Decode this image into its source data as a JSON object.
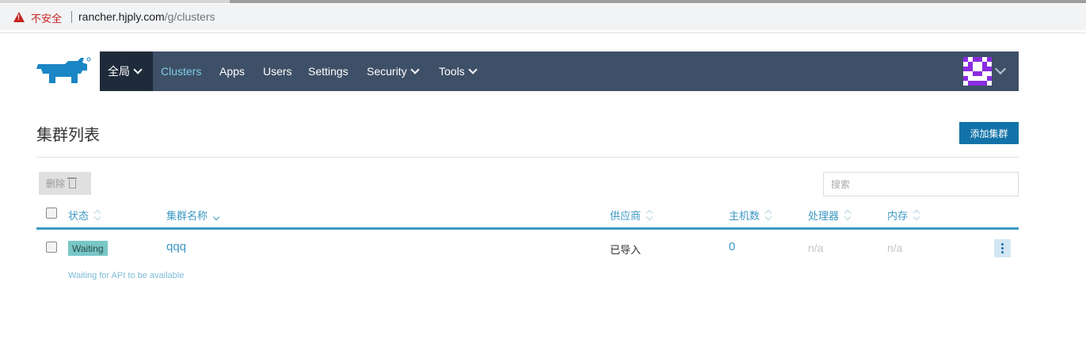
{
  "browser": {
    "insecure_label": "不安全",
    "url_host": "rancher.hjply.com",
    "url_path": "/g/clusters"
  },
  "nav": {
    "global_label": "全局",
    "items": [
      {
        "label": "Clusters"
      },
      {
        "label": "Apps"
      },
      {
        "label": "Users"
      },
      {
        "label": "Settings"
      },
      {
        "label": "Security"
      },
      {
        "label": "Tools"
      }
    ]
  },
  "header": {
    "title": "集群列表",
    "add_button": "添加集群"
  },
  "toolbar": {
    "delete_label": "删除",
    "search_placeholder": "搜索"
  },
  "table": {
    "columns": [
      "状态",
      "集群名称",
      "供应商",
      "主机数",
      "处理器",
      "内存"
    ],
    "rows": [
      {
        "state": "Waiting",
        "name": "qqq",
        "provider": "已导入",
        "nodes": "0",
        "cpu": "n/a",
        "memory": "n/a",
        "message": "Waiting for API to be available"
      }
    ]
  },
  "colors": {
    "nav_bg": "#3e5067",
    "nav_active": "#7ecbe6",
    "primary": "#1273a8",
    "link": "#3d98c4",
    "badge": "#79c7c7"
  }
}
